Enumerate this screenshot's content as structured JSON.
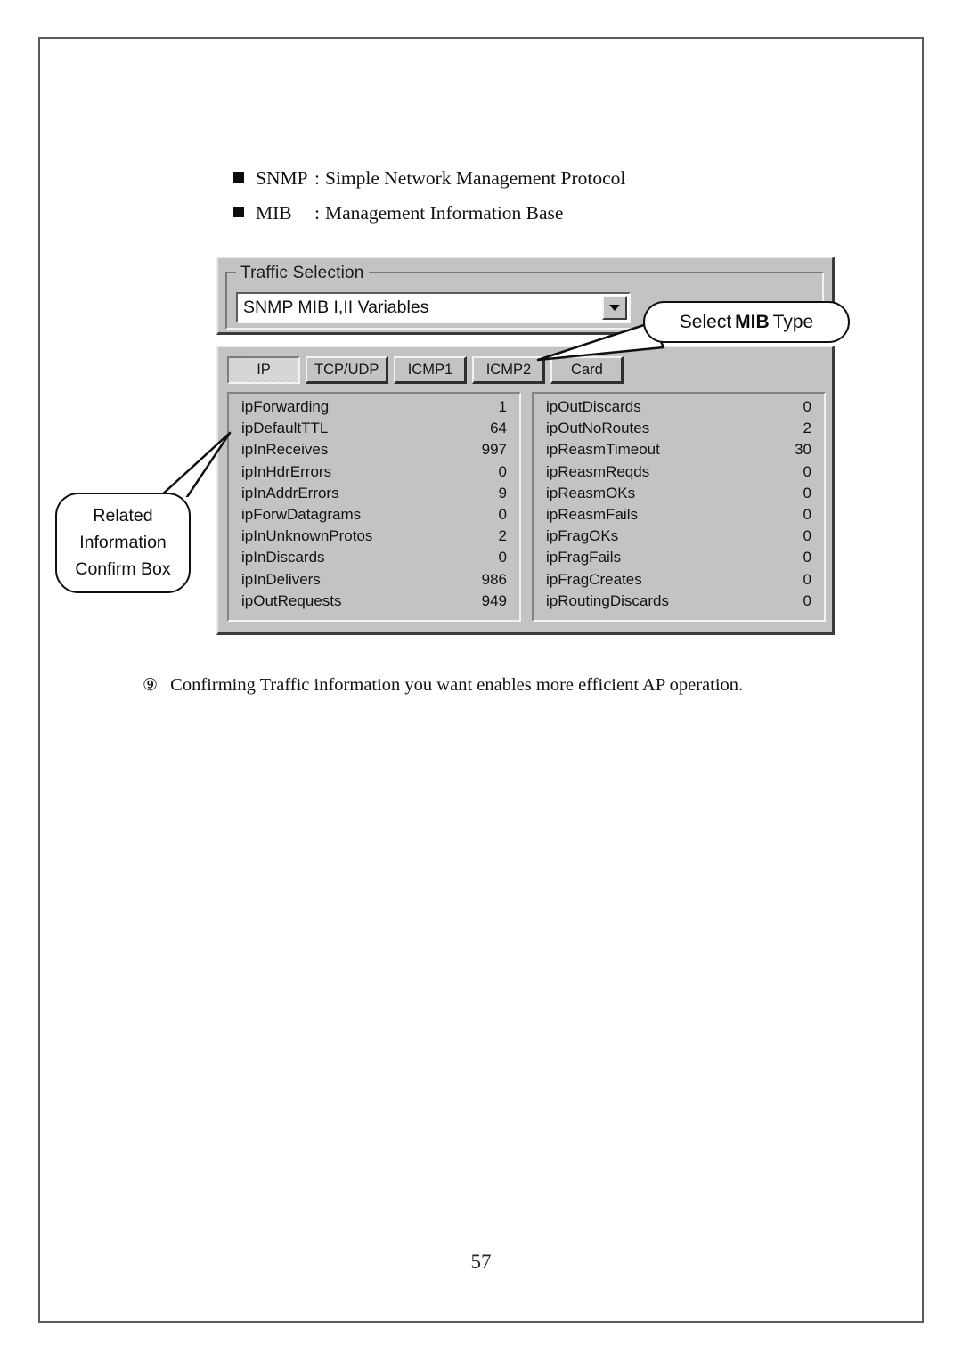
{
  "document": {
    "page_number": "57",
    "bullets": [
      {
        "marker": "filled-square",
        "term": "SNMP",
        "separator": ":",
        "definition": "Simple Network Management Protocol"
      },
      {
        "marker": "filled-square",
        "term": "MIB",
        "separator": ":",
        "definition": "Management Information Base"
      }
    ],
    "caption": {
      "step_marker": "⑨",
      "text": "Confirming Traffic information you want enables more efficient AP operation."
    }
  },
  "dialog": {
    "group_box": {
      "title": "Traffic Selection",
      "combo": {
        "value": "SNMP MIB I,II Variables",
        "arrow_icon": "chevron-down-icon"
      }
    },
    "tabs": [
      {
        "label": "IP",
        "selected": true
      },
      {
        "label": "TCP/UDP",
        "selected": false
      },
      {
        "label": "ICMP1",
        "selected": false
      },
      {
        "label": "ICMP2",
        "selected": false
      },
      {
        "label": "Card",
        "selected": false
      }
    ],
    "mib_table": {
      "left_column": [
        {
          "name": "ipForwarding",
          "value": "1"
        },
        {
          "name": "ipDefaultTTL",
          "value": "64"
        },
        {
          "name": "ipInReceives",
          "value": "997"
        },
        {
          "name": "ipInHdrErrors",
          "value": "0"
        },
        {
          "name": "ipInAddrErrors",
          "value": "9"
        },
        {
          "name": "ipForwDatagrams",
          "value": "0"
        },
        {
          "name": "ipInUnknownProtos",
          "value": "2"
        },
        {
          "name": "ipInDiscards",
          "value": "0"
        },
        {
          "name": "ipInDelivers",
          "value": "986"
        },
        {
          "name": "ipOutRequests",
          "value": "949"
        }
      ],
      "right_column": [
        {
          "name": "ipOutDiscards",
          "value": "0"
        },
        {
          "name": "ipOutNoRoutes",
          "value": "2"
        },
        {
          "name": "ipReasmTimeout",
          "value": "30"
        },
        {
          "name": "ipReasmReqds",
          "value": "0"
        },
        {
          "name": "ipReasmOKs",
          "value": "0"
        },
        {
          "name": "ipReasmFails",
          "value": "0"
        },
        {
          "name": "ipFragOKs",
          "value": "0"
        },
        {
          "name": "ipFragFails",
          "value": "0"
        },
        {
          "name": "ipFragCreates",
          "value": "0"
        },
        {
          "name": "ipRoutingDiscards",
          "value": "0"
        }
      ]
    }
  },
  "callouts": {
    "mib_type": {
      "prefix": "Select",
      "emphasis": "MIB",
      "suffix": "Type"
    },
    "related_info": {
      "line1": "Related",
      "line2": "Information",
      "line3": "Confirm Box"
    }
  },
  "colors": {
    "dialog_face": "#c3c3c3",
    "dialog_shadow": "#3b3b3b",
    "dialog_highlight": "#e8e8e8",
    "field_background": "#ffffff",
    "text": "#121212",
    "page_border": "#555b5e"
  }
}
